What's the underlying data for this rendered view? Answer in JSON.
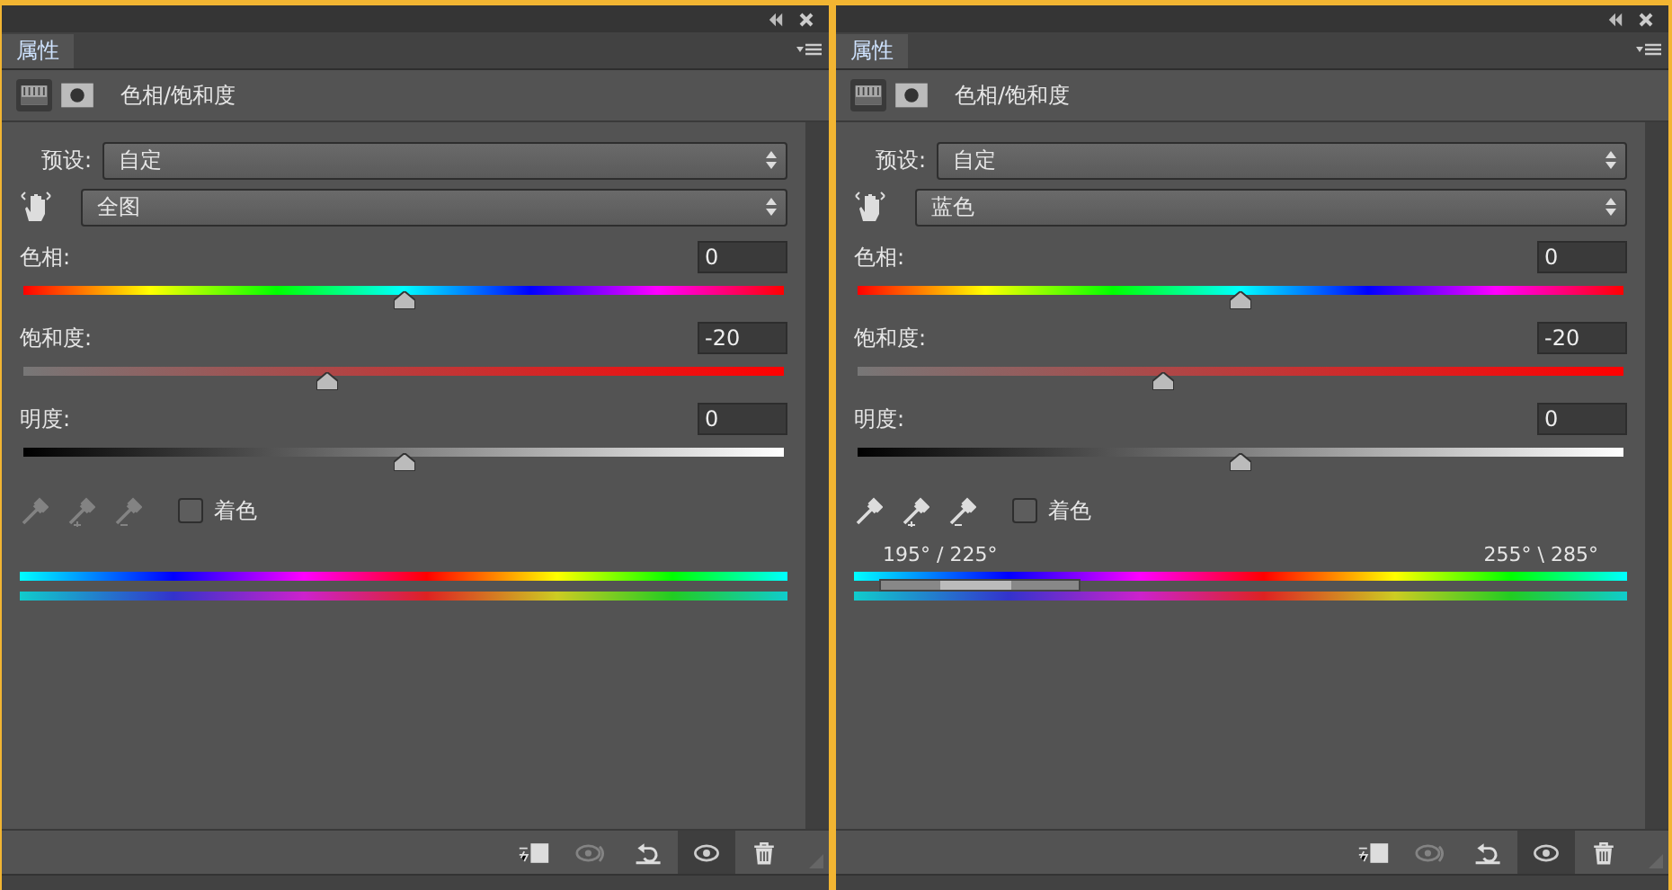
{
  "panels": [
    {
      "tab": {
        "label": "属性",
        "selected": true
      },
      "title": "色相/饱和度",
      "preset": {
        "label": "预设:",
        "value": "自定"
      },
      "range": {
        "value": "全图"
      },
      "sliders": [
        {
          "kind": "hue",
          "label": "色相:",
          "value": "0",
          "level": 0.5
        },
        {
          "kind": "saturation",
          "label": "饱和度:",
          "value": "-20",
          "level": 0.4
        },
        {
          "kind": "lightness",
          "label": "明度:",
          "value": "0",
          "level": 0.5
        }
      ],
      "tools_enabled": false,
      "colorize": {
        "label": "着色",
        "checked": false
      },
      "toolbar": [
        {
          "kind": "clip",
          "selected": false,
          "disabled": false
        },
        {
          "kind": "previous",
          "selected": false,
          "disabled": true
        },
        {
          "kind": "reset",
          "selected": false,
          "disabled": false
        },
        {
          "kind": "visibility",
          "selected": true,
          "disabled": false
        },
        {
          "kind": "delete",
          "selected": false,
          "disabled": false
        }
      ]
    },
    {
      "tab": {
        "label": "属性",
        "selected": true
      },
      "title": "色相/饱和度",
      "preset": {
        "label": "预设:",
        "value": "自定"
      },
      "range": {
        "value": "蓝色"
      },
      "sliders": [
        {
          "kind": "hue",
          "label": "色相:",
          "value": "0",
          "level": 0.5
        },
        {
          "kind": "saturation",
          "label": "饱和度:",
          "value": "-20",
          "level": 0.4
        },
        {
          "kind": "lightness",
          "label": "明度:",
          "value": "0",
          "level": 0.5
        }
      ],
      "tools_enabled": true,
      "colorize": {
        "label": "着色",
        "checked": false
      },
      "range_labels": [
        "195° / 225°",
        "255° \\ 285°"
      ],
      "toolbar": [
        {
          "kind": "clip",
          "selected": false,
          "disabled": false
        },
        {
          "kind": "previous",
          "selected": false,
          "disabled": true
        },
        {
          "kind": "reset",
          "selected": false,
          "disabled": false
        },
        {
          "kind": "visibility",
          "selected": true,
          "disabled": false
        },
        {
          "kind": "delete",
          "selected": false,
          "disabled": false
        }
      ]
    }
  ]
}
